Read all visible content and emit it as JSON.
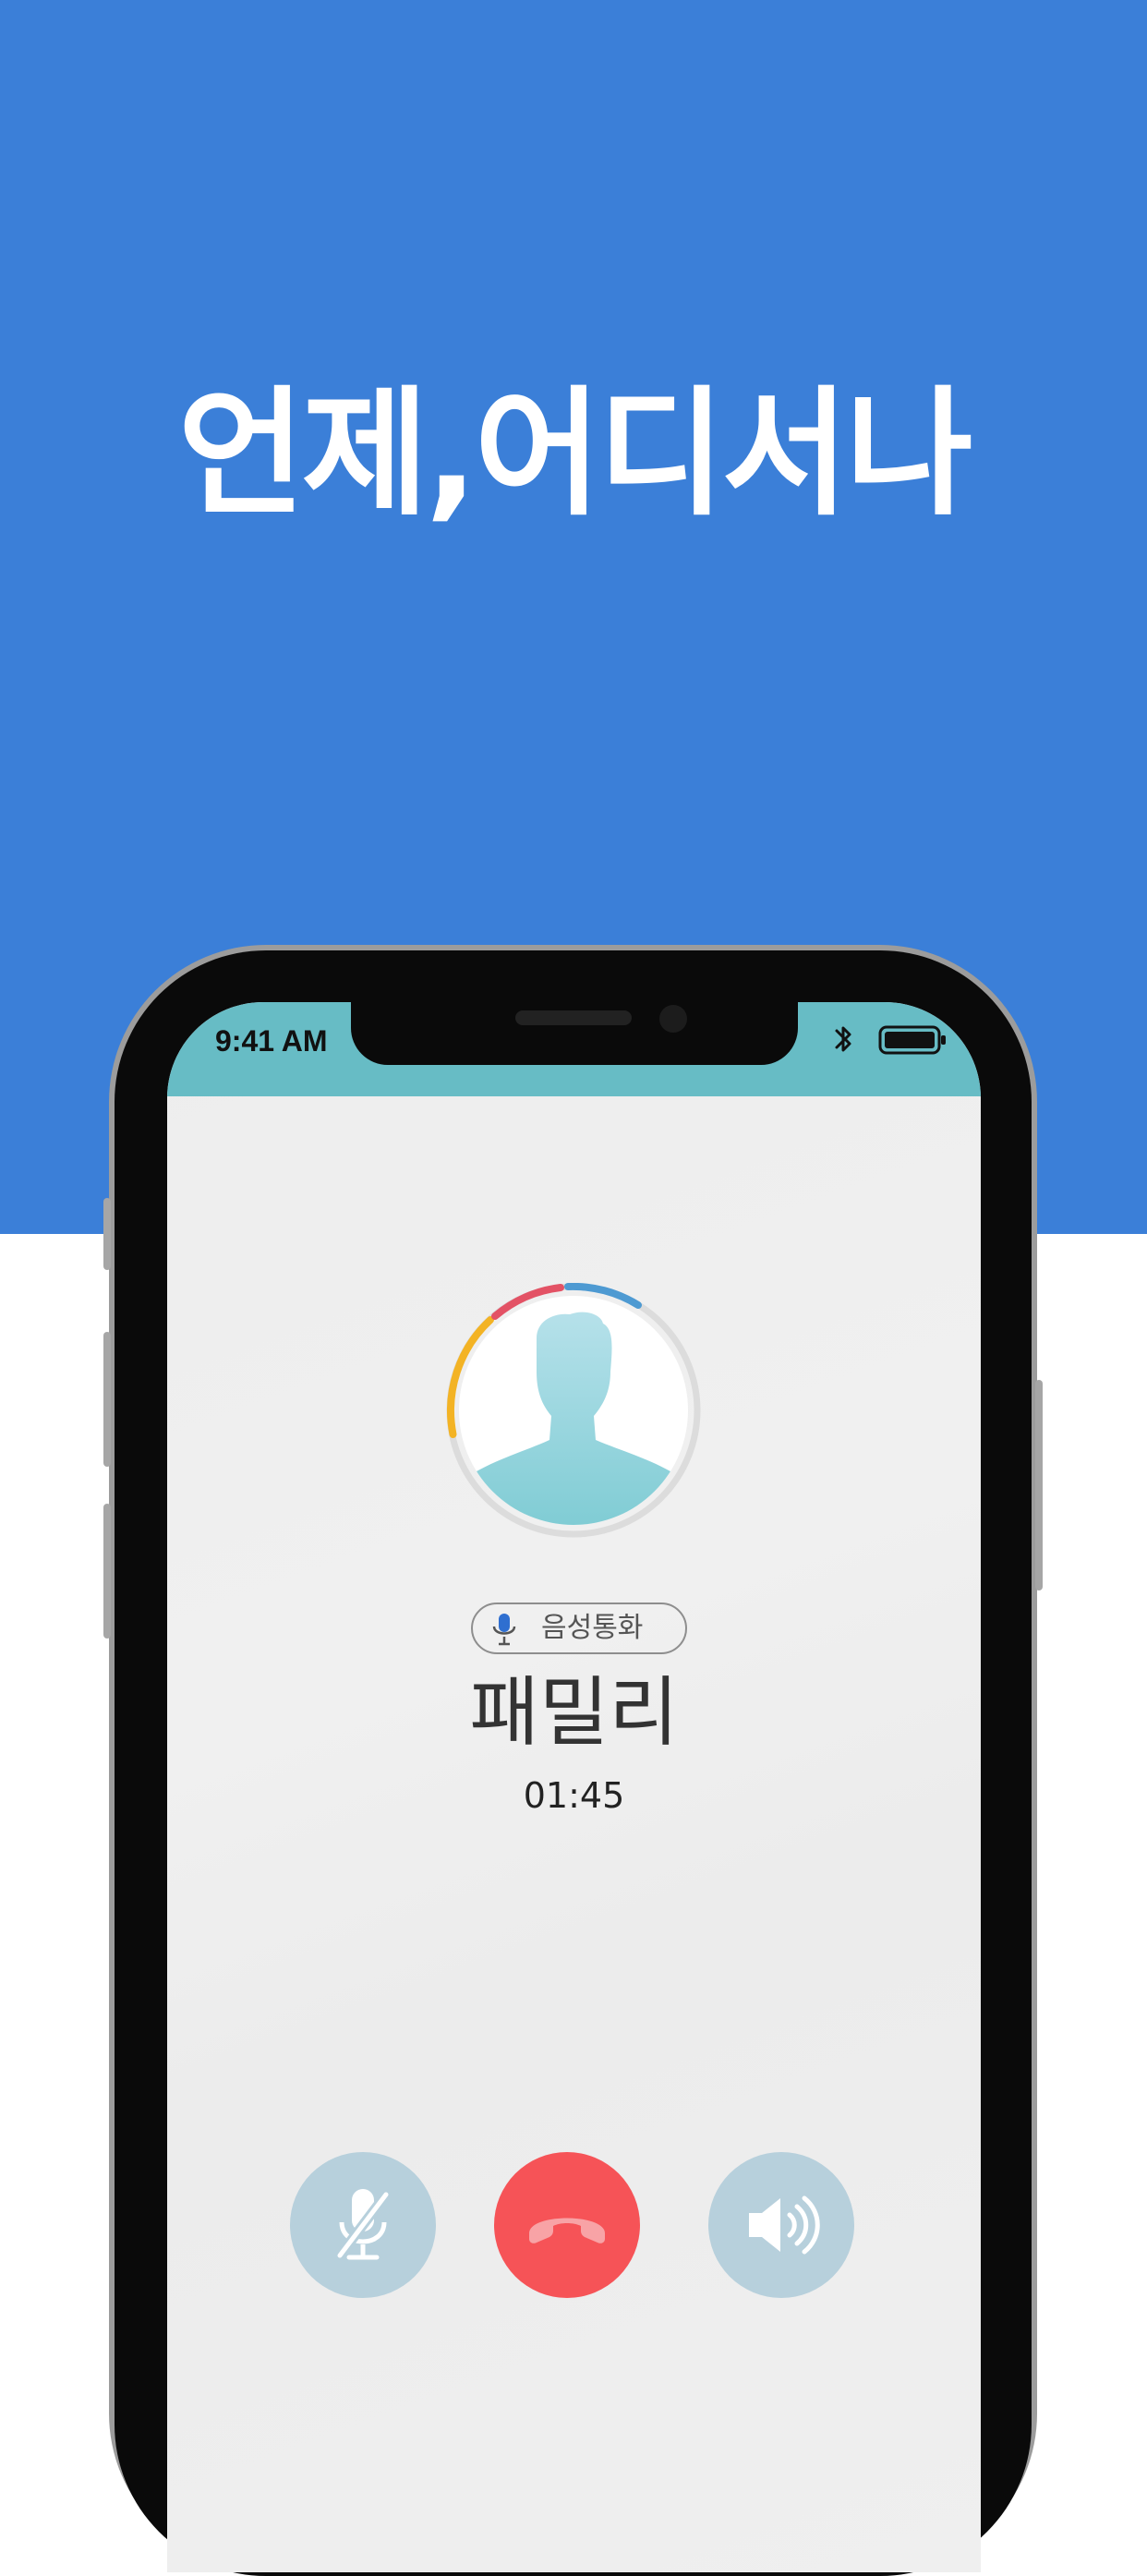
{
  "hero": {
    "headline": "언제,어디서나",
    "background": "#3b7fd8"
  },
  "status_bar": {
    "time": "9:41 AM",
    "icons": [
      "bluetooth-icon",
      "battery-icon"
    ],
    "background": "#67bcc5"
  },
  "call": {
    "type_icon": "microphone-icon",
    "type_label": "음성통화",
    "caller_name": "패밀리",
    "duration": "01:45",
    "avatar_icon": "person-silhouette-icon"
  },
  "controls": [
    {
      "name": "mute",
      "icon": "microphone-off-icon",
      "color": "#b7d0dc"
    },
    {
      "name": "end-call",
      "icon": "phone-hangup-icon",
      "color": "#f65357"
    },
    {
      "name": "speaker",
      "icon": "speaker-icon",
      "color": "#b7d0dc"
    }
  ]
}
